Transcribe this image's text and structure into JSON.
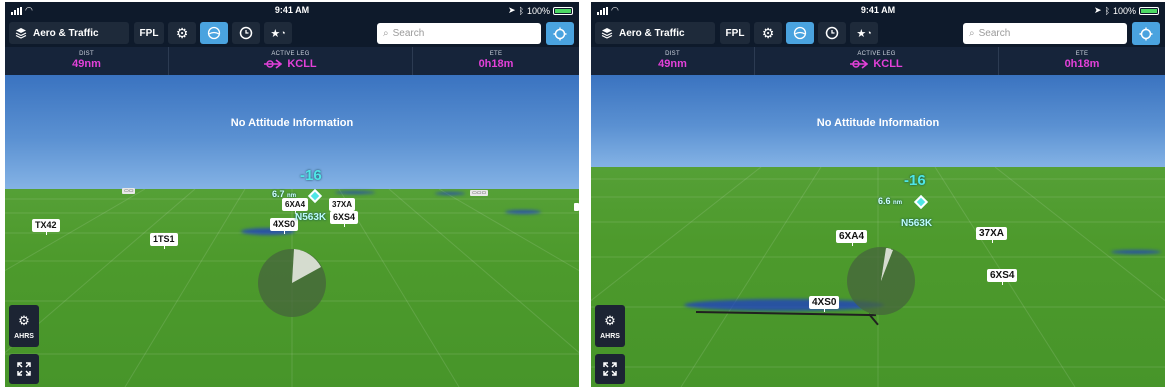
{
  "screens": [
    {
      "status": {
        "time": "9:41 AM",
        "battery": "100%",
        "battery_level": 1.0
      },
      "toolbar": {
        "layers_label": "Aero & Traffic",
        "fpl_label": "FPL",
        "search_placeholder": "Search",
        "favorites_glyph": "★",
        "icons": [
          "layers-icon",
          "gear-icon",
          "synthetic-vision-icon",
          "clock-icon",
          "favorites-icon",
          "search-icon",
          "locate-icon"
        ]
      },
      "info": {
        "dist_label": "DIST",
        "dist_value": "49nm",
        "leg_label": "ACTIVE LEG",
        "leg_value": "KCLL",
        "ete_label": "ETE",
        "ete_value": "0h18m",
        "value_color": "#e341d9"
      },
      "view": {
        "message": "No Attitude Information",
        "traffic": {
          "altitude": "-16",
          "distance": "6.7",
          "distance_unit": "nm",
          "callsign": "N563K",
          "color": "#4fe6e6"
        },
        "airports": [
          "TX42",
          "1TS1",
          "6XA4",
          "4XS0",
          "37XA",
          "6XS4"
        ],
        "ahrs_label": "AHRS"
      }
    },
    {
      "status": {
        "time": "9:41 AM",
        "battery": "100%",
        "battery_level": 1.0
      },
      "toolbar": {
        "layers_label": "Aero & Traffic",
        "fpl_label": "FPL",
        "search_placeholder": "Search",
        "favorites_glyph": "★"
      },
      "info": {
        "dist_label": "DIST",
        "dist_value": "49nm",
        "leg_label": "ACTIVE LEG",
        "leg_value": "KCLL",
        "ete_label": "ETE",
        "ete_value": "0h18m"
      },
      "view": {
        "message": "No Attitude Information",
        "traffic": {
          "altitude": "-16",
          "distance": "6.6",
          "distance_unit": "nm",
          "callsign": "N563K"
        },
        "airports": [
          "6XA4",
          "37XA",
          "6XS4",
          "4XS0"
        ],
        "ahrs_label": "AHRS"
      }
    }
  ]
}
